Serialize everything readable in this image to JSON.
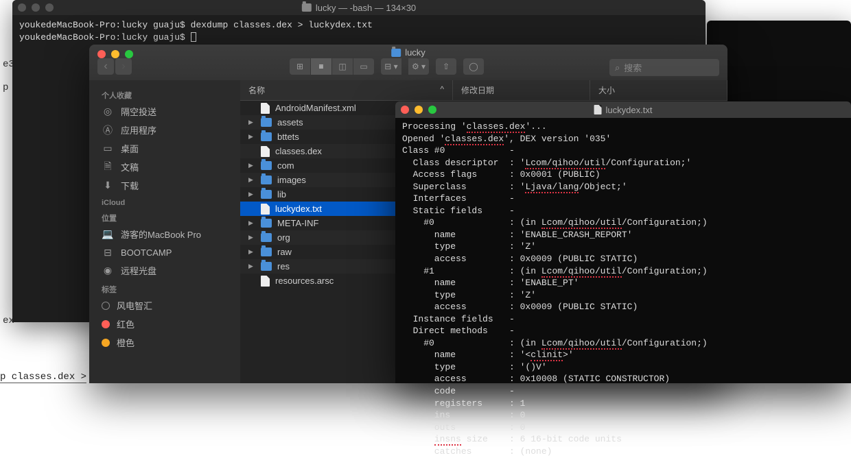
{
  "bg": {
    "a": "e3",
    "b": "p",
    "c": "ex",
    "d": "p classes.dex >"
  },
  "term1": {
    "title": "lucky — -bash — 134×30",
    "prompt_host": "youkedeMacBook-Pro:lucky guaju$",
    "cmd": "dexdump classes.dex > luckydex.txt"
  },
  "finder": {
    "title": "lucky",
    "search_placeholder": "搜索",
    "columns": {
      "name": "名称",
      "date": "修改日期",
      "size": "大小"
    },
    "sidebar": {
      "fav_header": "个人收藏",
      "fav": [
        "隔空投送",
        "应用程序",
        "桌面",
        "文稿",
        "下载"
      ],
      "icloud_header": "iCloud",
      "loc_header": "位置",
      "loc": [
        "游客的MacBook Pro",
        "BOOTCAMP",
        "远程光盘"
      ],
      "tags_header": "标签",
      "tags": [
        "风电智汇",
        "红色",
        "橙色"
      ],
      "colors": [
        "#888",
        "#ff5f57",
        "#f5a623"
      ]
    },
    "rows": [
      {
        "name": "AndroidManifest.xml",
        "folder": false,
        "d": false
      },
      {
        "name": "assets",
        "folder": true,
        "d": true
      },
      {
        "name": "bttets",
        "folder": true,
        "d": true
      },
      {
        "name": "classes.dex",
        "folder": false,
        "d": false
      },
      {
        "name": "com",
        "folder": true,
        "d": true
      },
      {
        "name": "images",
        "folder": true,
        "d": true
      },
      {
        "name": "lib",
        "folder": true,
        "d": true
      },
      {
        "name": "luckydex.txt",
        "folder": false,
        "d": false,
        "sel": true
      },
      {
        "name": "META-INF",
        "folder": true,
        "d": true
      },
      {
        "name": "org",
        "folder": true,
        "d": true
      },
      {
        "name": "raw",
        "folder": true,
        "d": true
      },
      {
        "name": "res",
        "folder": true,
        "d": true
      },
      {
        "name": "resources.arsc",
        "folder": false,
        "d": false
      }
    ]
  },
  "viewer": {
    "title": "luckydex.txt",
    "lines": [
      {
        "t": "Processing '",
        "u": "classes.dex",
        "r": "'..."
      },
      {
        "t": "Opened '",
        "u": "classes.dex",
        "r": "', DEX version '035'"
      },
      {
        "t": "Class #0            -"
      },
      {
        "t": "  Class descriptor  : '",
        "u": "Lcom/qihoo/util",
        "r": "/Configuration;'"
      },
      {
        "t": "  Access flags      : 0x0001 (PUBLIC)"
      },
      {
        "t": "  Superclass        : '",
        "u": "Ljava/lang",
        "r": "/Object;'"
      },
      {
        "t": "  Interfaces        -"
      },
      {
        "t": "  Static fields     -"
      },
      {
        "t": "    #0              : (in ",
        "u": "Lcom/qihoo/util",
        "r": "/Configuration;)"
      },
      {
        "t": "      name          : 'ENABLE_CRASH_REPORT'"
      },
      {
        "t": "      type          : 'Z'"
      },
      {
        "t": "      access        : 0x0009 (PUBLIC STATIC)"
      },
      {
        "t": "    #1              : (in ",
        "u": "Lcom/qihoo/util",
        "r": "/Configuration;)"
      },
      {
        "t": "      name          : 'ENABLE_PT'"
      },
      {
        "t": "      type          : 'Z'"
      },
      {
        "t": "      access        : 0x0009 (PUBLIC STATIC)"
      },
      {
        "t": "  Instance fields   -"
      },
      {
        "t": "  Direct methods    -"
      },
      {
        "t": "    #0              : (in ",
        "u": "Lcom/qihoo/util",
        "r": "/Configuration;)"
      },
      {
        "t": "      name          : '<",
        "u": "clinit",
        "r": ">'"
      },
      {
        "t": "      type          : '()V'"
      },
      {
        "t": "      access        : 0x10008 (STATIC CONSTRUCTOR)"
      },
      {
        "t": "      code          -"
      },
      {
        "t": "      registers     : 1"
      },
      {
        "t": "      ins           : 0"
      },
      {
        "t": "      outs          : 0"
      },
      {
        "t": "      ",
        "u": "insns",
        "r": " size    : 6 16-bit code units"
      },
      {
        "t": "      catches       : (none)"
      }
    ]
  }
}
